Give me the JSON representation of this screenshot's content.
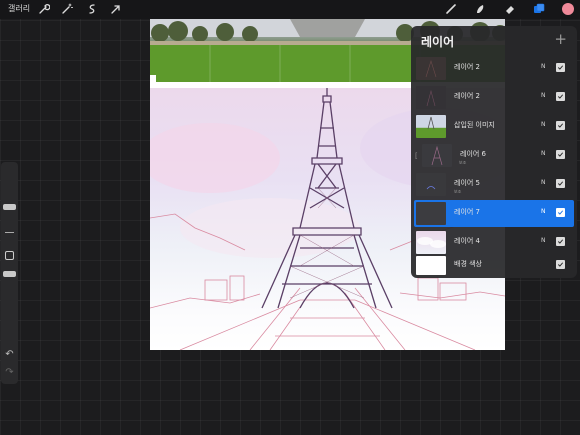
{
  "toolbar": {
    "gallery_label": "갤러리",
    "left_tools": [
      "wrench-icon",
      "magic-wand-icon",
      "selection-icon",
      "transform-arrow-icon"
    ],
    "right_tools": [
      "brush-icon",
      "smudge-icon",
      "eraser-icon",
      "layers-icon"
    ],
    "current_color": "#f08a9a"
  },
  "layers": {
    "title": "레이어",
    "add_symbol": "+",
    "items": [
      {
        "name": "레이어 2",
        "blend": "N",
        "visible": true,
        "thumb": "dark-sketch"
      },
      {
        "name": "레이어 2",
        "blend": "N",
        "visible": true,
        "thumb": "dark-sketch"
      },
      {
        "name": "삽입된 이미지",
        "blend": "N",
        "visible": true,
        "thumb": "photo"
      },
      {
        "name": "레이어 6",
        "sub": "보조",
        "blend": "N",
        "visible": true,
        "thumb": "tower"
      },
      {
        "name": "레이어 5",
        "sub": "보조",
        "blend": "N",
        "visible": true,
        "thumb": "arc"
      },
      {
        "name": "레이어 7",
        "blend": "N",
        "visible": true,
        "thumb": "empty",
        "active": true
      },
      {
        "name": "레이어 4",
        "blend": "N",
        "visible": true,
        "thumb": "clouds"
      },
      {
        "name": "배경 색상",
        "visible": true,
        "thumb": "white"
      }
    ]
  },
  "colors": {
    "accent": "#1a74e8",
    "panel_bg": "#28282a",
    "tower_line": "#5a3f66",
    "sketch_line": "#d98aa0"
  }
}
